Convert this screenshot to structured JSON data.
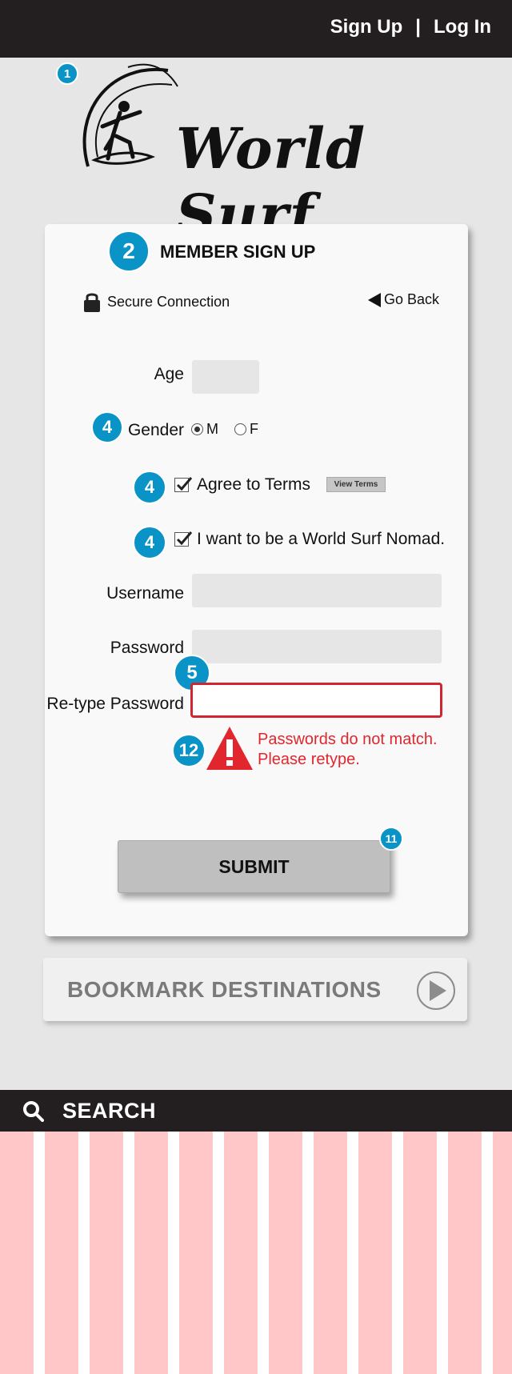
{
  "header": {
    "signup_label": "Sign Up",
    "separator": "|",
    "login_label": "Log In"
  },
  "logo": {
    "brand_text": "World Surf",
    "callout": "1"
  },
  "form": {
    "title": "MEMBER SIGN UP",
    "title_callout": "2",
    "secure_label": "Secure Connection",
    "goback_label": "Go Back",
    "age_label": "Age",
    "age_value": "",
    "gender_label": "Gender",
    "gender_callout": "4",
    "gender_options": [
      "M",
      "F"
    ],
    "gender_selected": "M",
    "terms_label": "Agree to Terms",
    "terms_callout": "4",
    "terms_checked": true,
    "view_terms_label": "View Terms",
    "nomad_label": "I want to be a World Surf Nomad.",
    "nomad_callout": "4",
    "nomad_checked": true,
    "username_label": "Username",
    "username_value": "",
    "password_label": "Password",
    "password_value": "",
    "password_callout": "5",
    "retype_label": "Re-type Password",
    "retype_value": "",
    "error_callout": "12",
    "error_line1": "Passwords do not match.",
    "error_line2": "Please retype.",
    "submit_label": "SUBMIT",
    "submit_callout": "11"
  },
  "bookmark": {
    "label": "BOOKMARK DESTINATIONS"
  },
  "search": {
    "label": "SEARCH"
  },
  "colors": {
    "dark_bar": "#231f20",
    "callout_blue": "#0a93c6",
    "error_red": "#e2262d",
    "stripe_pink": "#ffc7c8"
  }
}
